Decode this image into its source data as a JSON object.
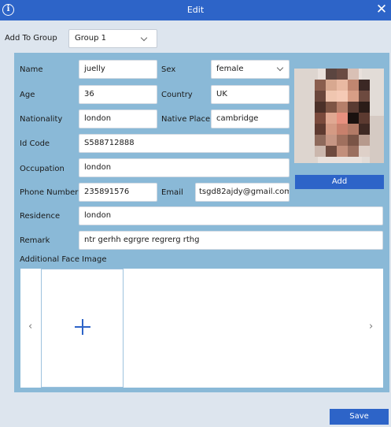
{
  "window": {
    "title": "Edit"
  },
  "group": {
    "label": "Add To Group",
    "value": "Group 1"
  },
  "form": {
    "name_label": "Name",
    "name_value": "juelly",
    "sex_label": "Sex",
    "sex_value": "female",
    "age_label": "Age",
    "age_value": "36",
    "country_label": "Country",
    "country_value": "UK",
    "nationality_label": "Nationality",
    "nationality_value": "london",
    "native_place_label": "Native Place",
    "native_place_value": "cambridge",
    "id_code_label": "Id Code",
    "id_code_value": "S588712888",
    "occupation_label": "Occupation",
    "occupation_value": "london",
    "phone_label": "Phone Number",
    "phone_value": "235891576",
    "email_label": "Email",
    "email_value": "tsgd82ajdy@gmail.com",
    "residence_label": "Residence",
    "residence_value": "london",
    "remark_label": "Remark",
    "remark_value": "ntr gerhh egrgre  regrerg rthg"
  },
  "photo": {
    "add_label": "Add"
  },
  "faces": {
    "label": "Additional Face Image"
  },
  "footer": {
    "save_label": "Save"
  },
  "icons": {
    "info": "info-icon",
    "close": "close-icon",
    "add_face": "plus-icon",
    "prev": "chevron-left-icon",
    "next": "chevron-right-icon",
    "dropdown": "chevron-down-icon"
  },
  "colors": {
    "accent": "#2d64c8",
    "panel": "#8ab9d7",
    "background": "#dde5ee"
  }
}
